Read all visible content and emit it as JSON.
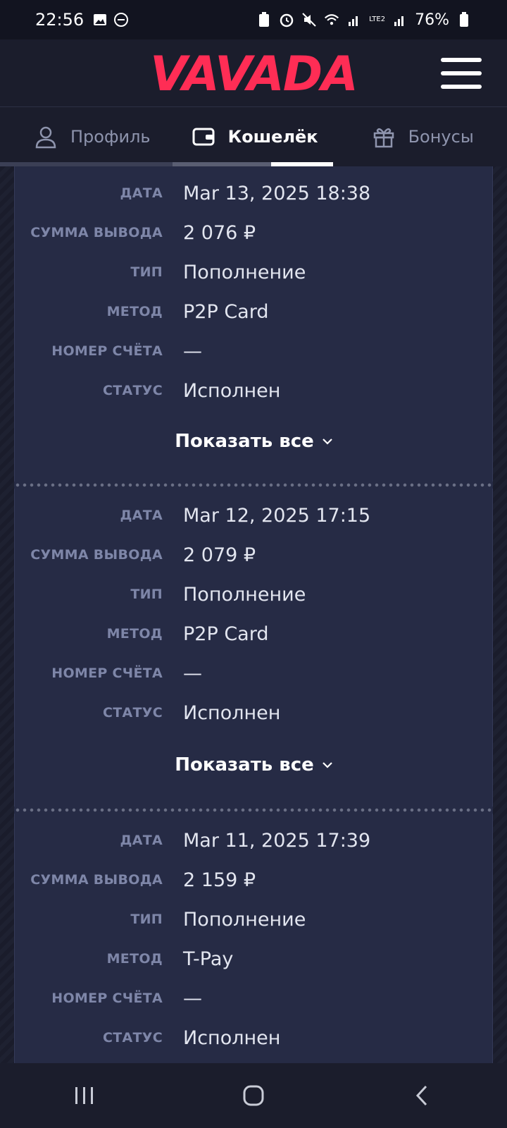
{
  "statusbar": {
    "time": "22:56",
    "battery": "76%",
    "network": "LTE2"
  },
  "header": {
    "logo_text": "VAVADA",
    "brand_color": "#ff2d55"
  },
  "tabs": [
    {
      "label": "Профиль",
      "icon": "user-icon"
    },
    {
      "label": "Кошелёк",
      "icon": "wallet-icon",
      "active": true
    },
    {
      "label": "Бонусы",
      "icon": "gift-icon"
    }
  ],
  "transactions": [
    {
      "date_label": "ДАТА",
      "date": "Mar 13, 2025 18:38",
      "amount_label": "СУММА ВЫВОДА",
      "amount": "2 076 ₽",
      "type_label": "ТИП",
      "type": "Пополнение",
      "method_label": "МЕТОД",
      "method": "P2P Card",
      "account_label": "НОМЕР СЧЁТА",
      "account": "—",
      "status_label": "СТАТУС",
      "status": "Исполнен",
      "show_all": "Показать все"
    },
    {
      "date_label": "ДАТА",
      "date": "Mar 12, 2025 17:15",
      "amount_label": "СУММА ВЫВОДА",
      "amount": "2 079 ₽",
      "type_label": "ТИП",
      "type": "Пополнение",
      "method_label": "МЕТОД",
      "method": "P2P Card",
      "account_label": "НОМЕР СЧЁТА",
      "account": "—",
      "status_label": "СТАТУС",
      "status": "Исполнен",
      "show_all": "Показать все"
    },
    {
      "date_label": "ДАТА",
      "date": "Mar 11, 2025 17:39",
      "amount_label": "СУММА ВЫВОДА",
      "amount": "2 159 ₽",
      "type_label": "ТИП",
      "type": "Пополнение",
      "method_label": "МЕТОД",
      "method": "T-Pay",
      "account_label": "НОМЕР СЧЁТА",
      "account": "—",
      "status_label": "СТАТУС",
      "status": "Исполнен"
    }
  ]
}
